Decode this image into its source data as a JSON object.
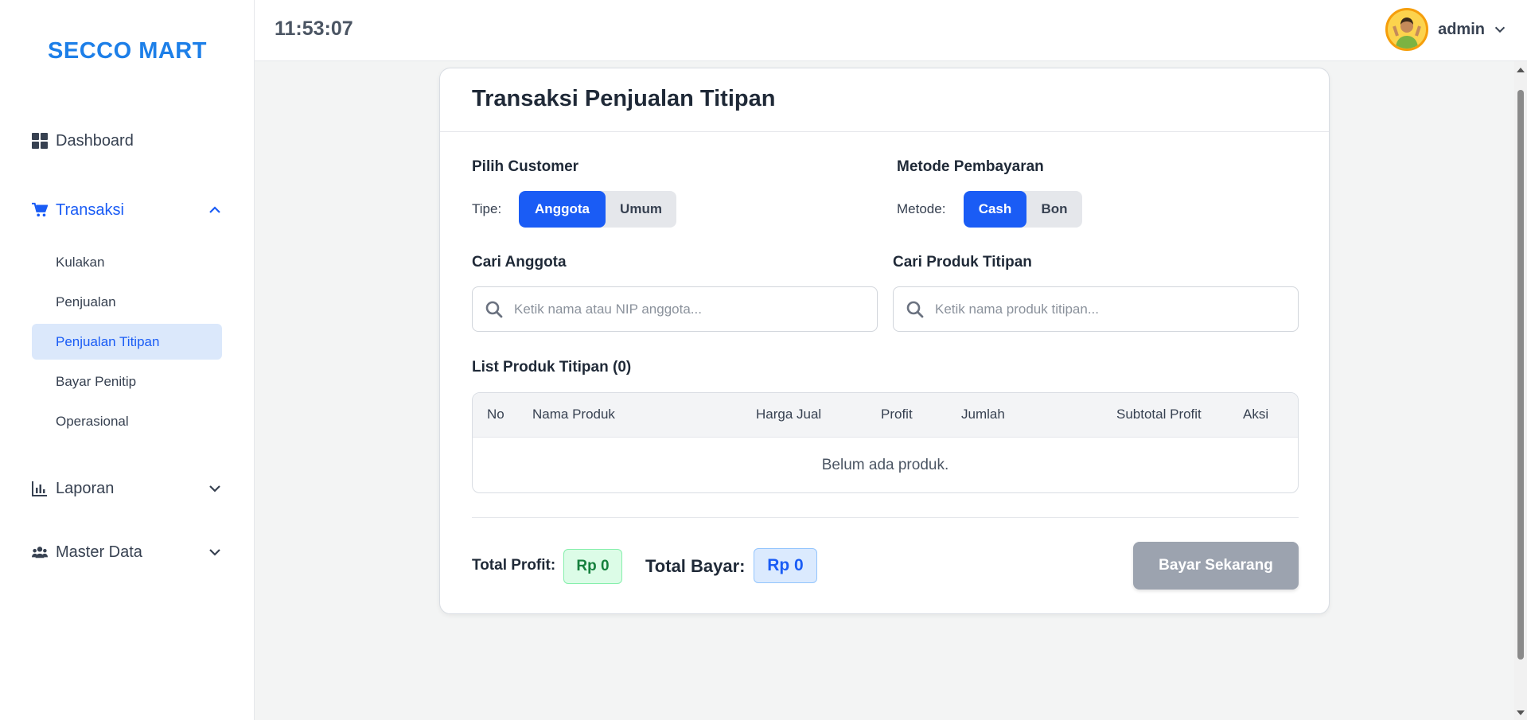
{
  "brand": "SECCO MART",
  "clock": "11:53:07",
  "user": {
    "name": "admin"
  },
  "sidebar": {
    "dashboard": "Dashboard",
    "transaksi": "Transaksi",
    "sub_items": [
      "Kulakan",
      "Penjualan",
      "Penjualan Titipan",
      "Bayar Penitip",
      "Operasional"
    ],
    "laporan": "Laporan",
    "master_data": "Master Data"
  },
  "card": {
    "title": "Transaksi Penjualan Titipan",
    "customer_section": "Pilih Customer",
    "tipe_label": "Tipe:",
    "tipe_options": [
      "Anggota",
      "Umum"
    ],
    "tipe_selected": "Anggota",
    "payment_section": "Metode Pembayaran",
    "metode_label": "Metode:",
    "metode_options": [
      "Cash",
      "Bon"
    ],
    "metode_selected": "Cash",
    "search_member_label": "Cari Anggota",
    "search_member_placeholder": "Ketik nama atau NIP anggota...",
    "search_product_label": "Cari Produk Titipan",
    "search_product_placeholder": "Ketik nama produk titipan...",
    "list_title": "List Produk Titipan (0)",
    "table_headers": [
      "No",
      "Nama Produk",
      "Harga Jual",
      "Profit",
      "Jumlah",
      "Subtotal Profit",
      "Aksi"
    ],
    "empty_text": "Belum ada produk.",
    "total_profit_label": "Total Profit:",
    "total_profit_value": "Rp 0",
    "total_bayar_label": "Total Bayar:",
    "total_bayar_value": "Rp 0",
    "pay_button": "Bayar Sekarang"
  },
  "colors": {
    "accent": "#1a5cf5",
    "brand": "#1d7fe8",
    "profit_bg": "#dcfce7",
    "bayar_bg": "#dbeafe",
    "disabled_button": "#9ca3af"
  }
}
